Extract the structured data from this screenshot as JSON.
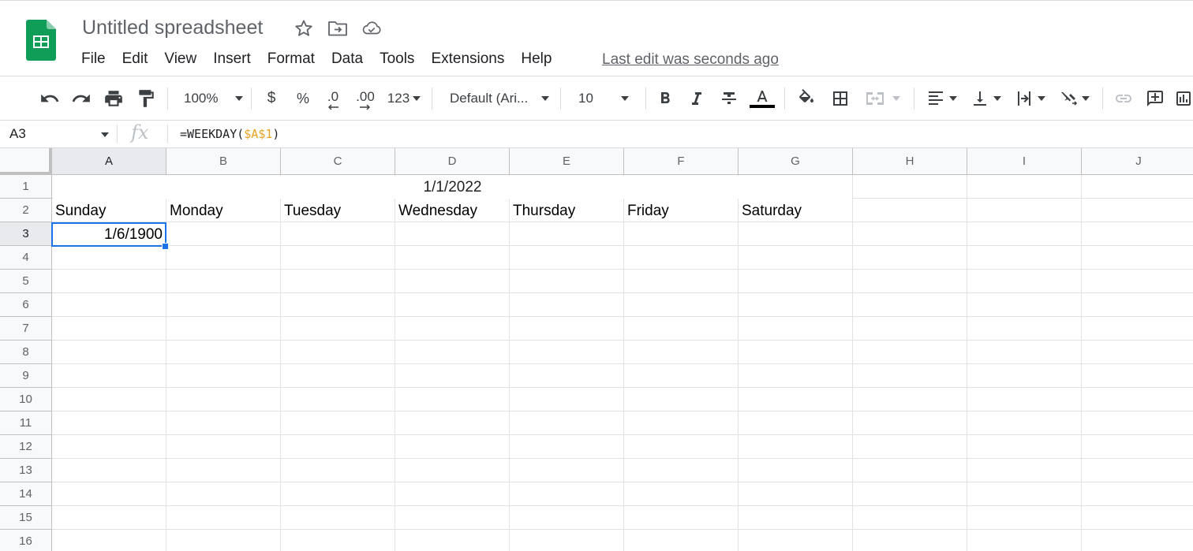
{
  "app": {
    "title": "Untitled spreadsheet",
    "last_edit": "Last edit was seconds ago",
    "brand_color": "#0f9d58",
    "selection_color": "#1a73e8"
  },
  "title_icons": [
    "star-icon",
    "move-to-folder-icon",
    "cloud-saved-icon"
  ],
  "menu": [
    "File",
    "Edit",
    "View",
    "Insert",
    "Format",
    "Data",
    "Tools",
    "Extensions",
    "Help"
  ],
  "toolbar": {
    "zoom": "100%",
    "currency": "$",
    "percent": "%",
    "decrease_decimal": ".0",
    "increase_decimal": ".00",
    "more_formats": "123",
    "font": "Default (Ari...",
    "font_size": "10",
    "text_color": "#000000",
    "icons": [
      "undo-icon",
      "redo-icon",
      "print-icon",
      "paint-format-icon",
      "bold-icon",
      "italic-icon",
      "strikethrough-icon",
      "text-color-icon",
      "fill-color-icon",
      "borders-icon",
      "merge-cells-icon",
      "horizontal-align-icon",
      "vertical-align-icon",
      "text-wrapping-icon",
      "text-rotation-icon",
      "insert-link-icon",
      "insert-comment-icon",
      "insert-chart-icon"
    ]
  },
  "formula_bar": {
    "name_box": "A3",
    "fx": "fx",
    "formula_prefix": "=WEEKDAY(",
    "formula_ref": "$A$1",
    "formula_suffix": ")",
    "ref_color": "#e8a21e"
  },
  "grid": {
    "columns": [
      "A",
      "B",
      "C",
      "D",
      "E",
      "F",
      "G",
      "H",
      "I",
      "J"
    ],
    "rows": [
      "1",
      "2",
      "3",
      "4",
      "5",
      "6",
      "7",
      "8",
      "9",
      "10",
      "11",
      "12",
      "13",
      "14",
      "15",
      "16"
    ],
    "active_column": "A",
    "active_row": "3",
    "merged_cell_A1_G1": "1/1/2022",
    "row2": [
      "Sunday",
      "Monday",
      "Tuesday",
      "Wednesday",
      "Thursday",
      "Friday",
      "Saturday"
    ],
    "cell_A3": "1/6/1900"
  }
}
